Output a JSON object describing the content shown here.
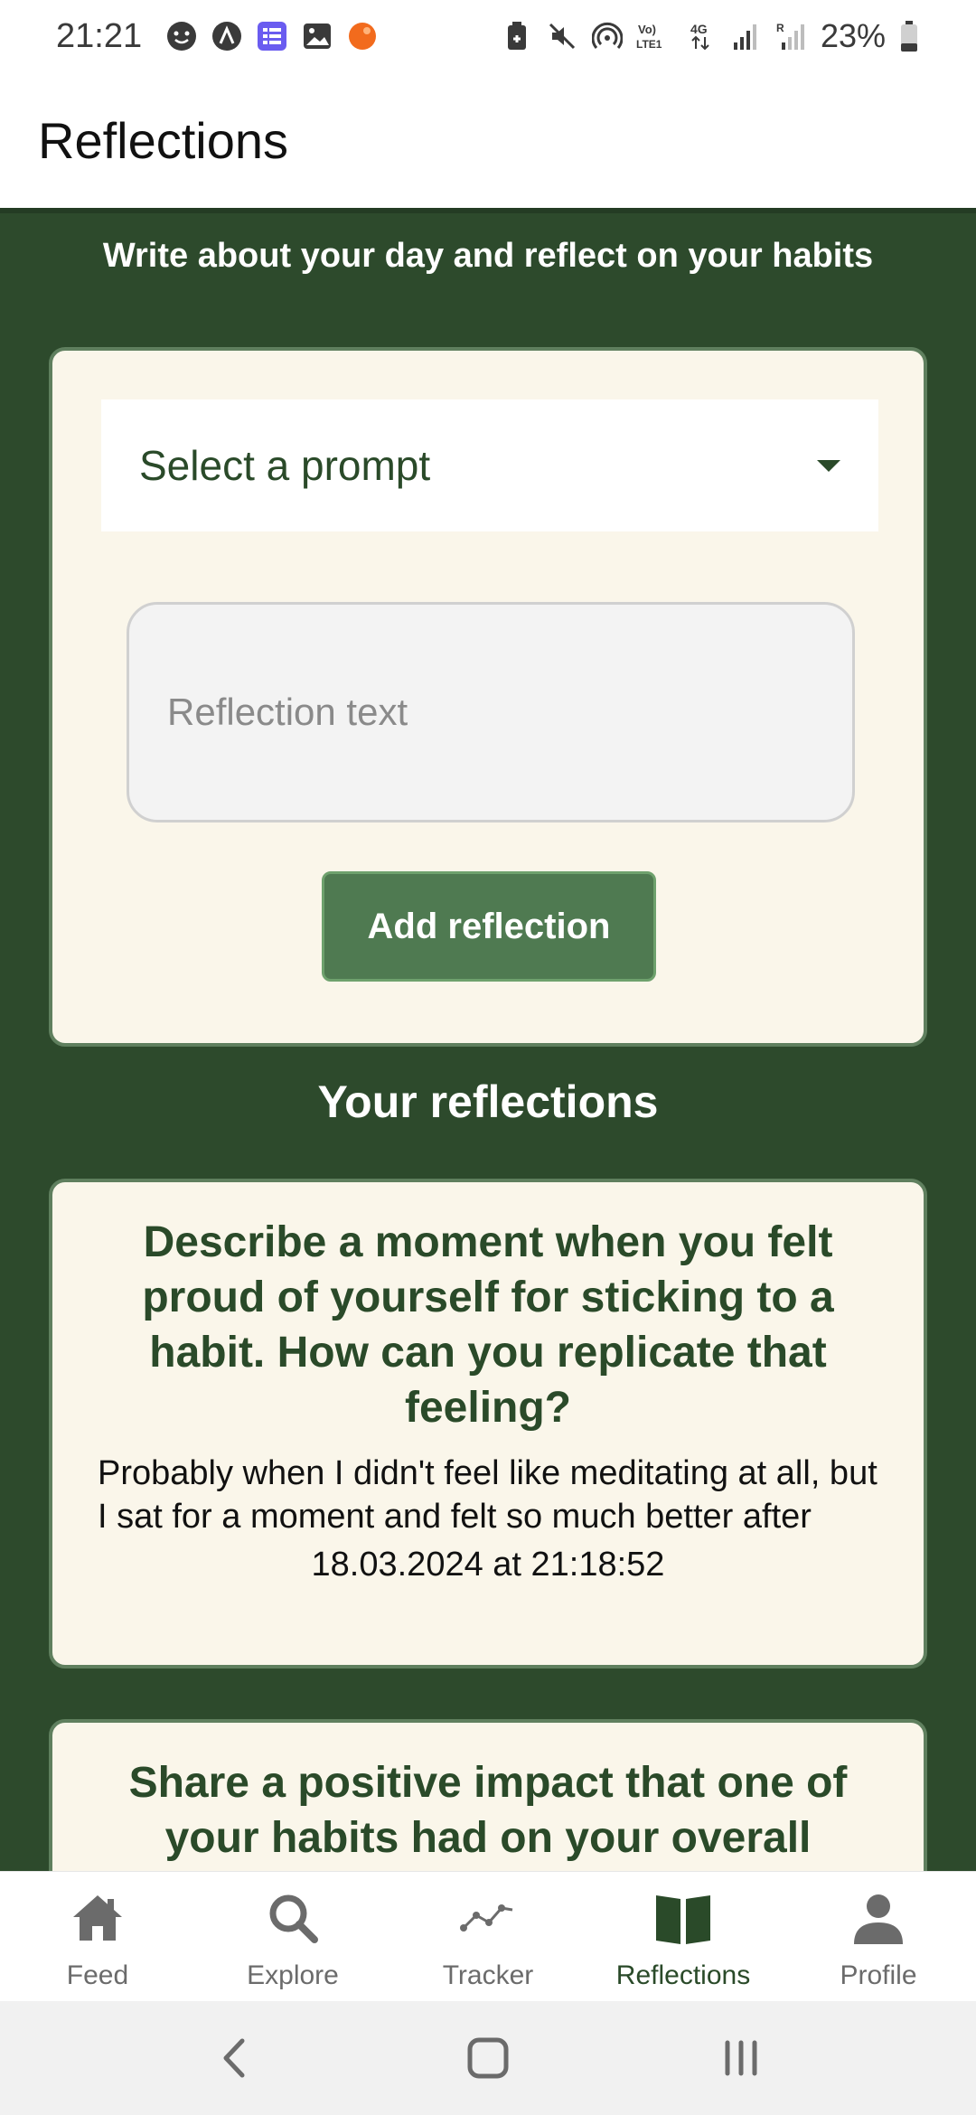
{
  "status_bar": {
    "time": "21:21",
    "battery": "23%",
    "left_icons": [
      "face-icon",
      "a-icon",
      "list-app-icon",
      "gallery-icon",
      "orange-dot-icon"
    ],
    "right_icons": [
      "battery-saver-icon",
      "mute-icon",
      "hotspot-icon",
      "volte-icon",
      "4g-icon",
      "signal-icon",
      "signal-roaming-icon",
      "battery-icon"
    ],
    "volte_label": "Vo)\nLTE1",
    "network_label": "4G"
  },
  "header": {
    "title": "Reflections"
  },
  "main": {
    "subtitle": "Write about your day and reflect on your habits",
    "form": {
      "select_label": "Select a prompt",
      "input_placeholder": "Reflection text",
      "input_value": "",
      "add_button_label": "Add reflection"
    },
    "section_title": "Your reflections",
    "reflections": [
      {
        "prompt": "Describe a moment when you felt proud of yourself for sticking to a habit. How can you replicate that feeling?",
        "text": "Probably when I didn't feel like meditating at all, but I sat for a moment and felt so much better after",
        "date": "18.03.2024 at 21:18:52"
      },
      {
        "prompt": "Share a positive impact that one of your habits had on your overall"
      }
    ]
  },
  "tabs": [
    {
      "label": "Feed",
      "icon": "home-icon",
      "active": false
    },
    {
      "label": "Explore",
      "icon": "search-icon",
      "active": false
    },
    {
      "label": "Tracker",
      "icon": "chart-line-icon",
      "active": false
    },
    {
      "label": "Reflections",
      "icon": "book-open-icon",
      "active": true
    },
    {
      "label": "Profile",
      "icon": "person-icon",
      "active": false
    }
  ],
  "colors": {
    "background_green": "#2d4a2c",
    "card_bg": "#faf6ea",
    "accent_green": "#4f7a51",
    "text_green": "#2a4a29",
    "inactive_icon": "#6b6b6b"
  }
}
